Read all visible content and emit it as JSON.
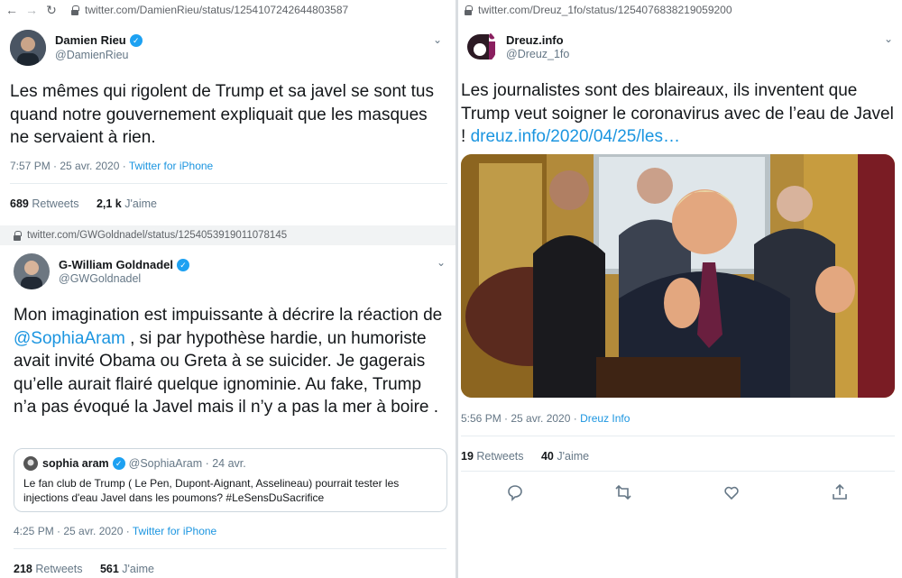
{
  "left_top": {
    "url": "twitter.com/DamienRieu/status/1254107242644803587",
    "author_name": "Damien Rieu",
    "author_handle": "@DamienRieu",
    "text": "Les mêmes qui rigolent de Trump et sa javel se sont tus quand notre gouvernement expliquait que les masques ne servaient à rien.",
    "timestamp": "7:57 PM · 25 avr. 2020 · ",
    "source": "Twitter for iPhone",
    "retweets_count": "689",
    "retweets_label": "Retweets",
    "likes_count": "2,1 k",
    "likes_label": "J'aime"
  },
  "left_bottom": {
    "url": "twitter.com/GWGoldnadel/status/1254053919011078145",
    "author_name": "G-William Goldnadel",
    "author_handle": "@GWGoldnadel",
    "text_before": "Mon imagination est impuissante à décrire la réaction de ",
    "mention": "@SophiaAram",
    "text_after": " , si par hypothèse hardie, un humoriste avait invité Obama ou Greta à se suicider. Je gagerais qu’elle aurait flairé quelque ignominie. Au fake, Trump n’a pas évoqué la Javel mais il n’y a pas la mer à boire .",
    "quote": {
      "name": "sophia aram",
      "handle_date": "@SophiaAram · 24 avr.",
      "text": "Le fan club de Trump ( Le Pen, Dupont-Aignant, Asselineau)  pourrait tester les injections d'eau Javel dans les poumons? #LeSensDuSacrifice"
    },
    "timestamp": "4:25 PM · 25 avr. 2020 · ",
    "source": "Twitter for iPhone",
    "retweets_count": "218",
    "retweets_label": "Retweets",
    "likes_count": "561",
    "likes_label": "J'aime"
  },
  "right": {
    "url": "twitter.com/Dreuz_1fo/status/1254076838219059200",
    "author_name": "Dreuz.info",
    "author_handle": "@Dreuz_1fo",
    "text": "Les journalistes sont des blaireaux, ils inventent que Trump veut soigner le coronavirus avec de l’eau de Javel ! ",
    "link": "dreuz.info/2020/04/25/les…",
    "timestamp": "5:56 PM · 25 avr. 2020 · ",
    "source": "Dreuz Info",
    "retweets_count": "19",
    "retweets_label": "Retweets",
    "likes_count": "40",
    "likes_label": "J'aime"
  },
  "icons": [
    "back-arrow-icon",
    "forward-arrow-icon",
    "reload-icon",
    "lock-icon",
    "verified-badge-icon",
    "chevron-down-icon",
    "reply-icon",
    "retweet-icon",
    "like-icon",
    "share-icon"
  ],
  "colors": {
    "link": "#1b95e0",
    "verified": "#1da1f2",
    "muted": "#657786"
  }
}
